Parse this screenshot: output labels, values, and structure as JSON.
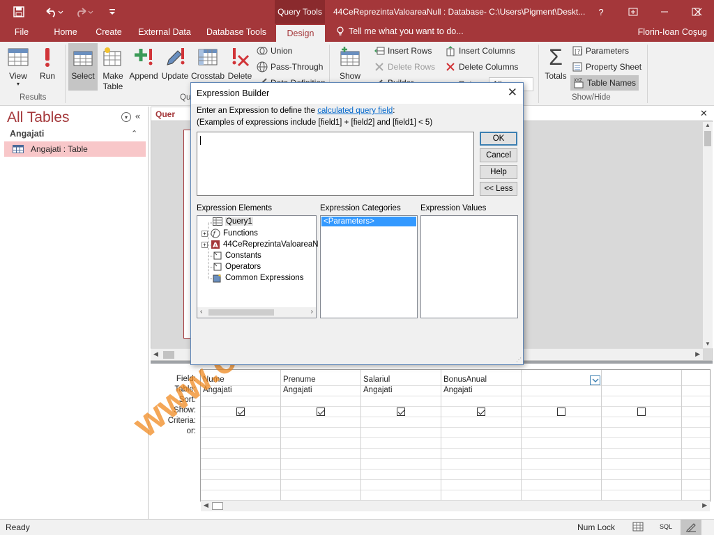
{
  "titlebar": {
    "context_tab": "Query Tools",
    "document_title": "44CeReprezintaValoareaNull : Database- C:\\Users\\Pigment\\Deskt...",
    "help": "?"
  },
  "tabs": [
    {
      "label": "File"
    },
    {
      "label": "Home"
    },
    {
      "label": "Create"
    },
    {
      "label": "External Data"
    },
    {
      "label": "Database Tools"
    },
    {
      "label": "Design"
    }
  ],
  "tellme": "Tell me what you want to do...",
  "user": "Florin-Ioan Coşug",
  "ribbon": {
    "view": "View",
    "run": "Run",
    "results_group": "Results",
    "select": "Select",
    "make_table": "Make Table",
    "append": "Append",
    "update": "Update",
    "crosstab": "Crosstab",
    "delete": "Delete",
    "union": "Union",
    "pass_through": "Pass-Through",
    "data_definition": "Data Definition",
    "query_type_group": "Qu",
    "show_table": "Show",
    "insert_rows": "Insert Rows",
    "delete_rows": "Delete Rows",
    "builder": "Builder",
    "insert_columns": "Insert Columns",
    "delete_columns": "Delete Columns",
    "return": "Return:",
    "return_value": "All",
    "totals": "Totals",
    "parameters": "Parameters",
    "property_sheet": "Property Sheet",
    "table_names": "Table Names",
    "showhide_group": "Show/Hide"
  },
  "nav": {
    "title": "All Tables",
    "group": "Angajati",
    "item": "Angajati : Table"
  },
  "doc_tab": "Quer",
  "grid": {
    "row_labels": [
      "Field:",
      "Table:",
      "Sort:",
      "Show:",
      "Criteria:",
      "or:"
    ],
    "columns": [
      {
        "field": "Nume",
        "table": "Angajati",
        "show": true
      },
      {
        "field": "Prenume",
        "table": "Angajati",
        "show": true
      },
      {
        "field": "Salariul",
        "table": "Angajati",
        "show": true
      },
      {
        "field": "BonusAnual",
        "table": "Angajati",
        "show": true
      },
      {
        "field": "",
        "table": "",
        "show": false
      },
      {
        "field": "",
        "table": "",
        "show": false
      }
    ]
  },
  "status": {
    "left": "Ready",
    "numlock": "Num Lock",
    "sql": "SQL"
  },
  "dialog": {
    "title": "Expression Builder",
    "instruction_prefix": "Enter an Expression to define the ",
    "instruction_link": "calculated query field",
    "instruction_suffix": ":",
    "examples": "(Examples of expressions include [field1] + [field2] and [field1] < 5)",
    "ok": "OK",
    "cancel": "Cancel",
    "help": "Help",
    "less": "<< Less",
    "elements_label": "Expression Elements",
    "categories_label": "Expression Categories",
    "values_label": "Expression Values",
    "elements": [
      "Query1",
      "Functions",
      "44CeReprezintaValoareaN",
      "Constants",
      "Operators",
      "Common Expressions"
    ],
    "categories": [
      "<Parameters>"
    ]
  },
  "watermark": "www.office-learning.ro"
}
